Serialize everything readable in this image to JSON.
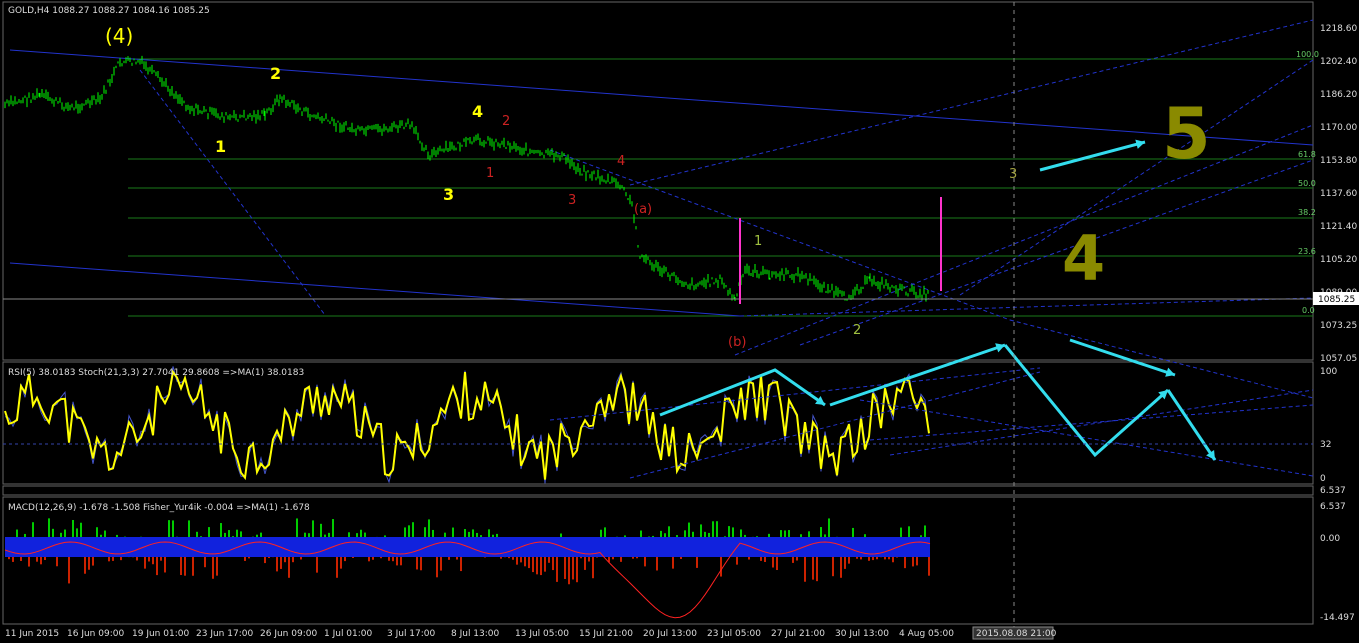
{
  "colors": {
    "background": "#000000",
    "candles": "#00ff00",
    "rsi": "#ffff00",
    "trend_lines": "#2233cc",
    "fib_levels": "#1a7a1a",
    "arrows": "#33ddee",
    "macd_hist_pos": "#00cc00",
    "macd_hist_neg": "#cc2200",
    "magenta": "#ff33cc",
    "big_numbers": "#8a8a00"
  },
  "main": {
    "header": "GOLD,H4  1088.27 1088.27 1084.16 1085.25",
    "current_price": "1085.25",
    "price_ticks": [
      "1218.60",
      "1202.40",
      "1186.20",
      "1170.00",
      "1153.80",
      "1137.60",
      "1121.40",
      "1105.20",
      "1089.00",
      "1073.25",
      "1057.05"
    ],
    "fib_labels": [
      "100.0",
      "61.8",
      "50.0",
      "38.2",
      "23.6",
      "0.0"
    ],
    "wave_labels": {
      "w4_main": "(4)",
      "y2": "2",
      "y1": "1",
      "y3": "3",
      "y4": "4",
      "r2": "2",
      "r1": "1",
      "r3": "3",
      "r4": "4",
      "ra": "(a)",
      "rb": "(b)",
      "g1": "1",
      "g2": "2",
      "g3": "3",
      "big5": "5",
      "big4": "4"
    }
  },
  "rsi": {
    "header": "RSI(5) 38.0183  Stoch(21,3,3) 27.7041 29.8608  =>MA(1) 38.0183",
    "ticks": [
      "100",
      "32",
      "0"
    ]
  },
  "mini": {
    "ticks": [
      "6.537",
      "0.00"
    ]
  },
  "macd": {
    "header": "MACD(12,26,9) -1.678 -1.508  Fisher_Yur4ik -0.004  =>MA(1) -1.678",
    "ticks": [
      "6.537",
      "0.00",
      "-14.497"
    ]
  },
  "time_axis": {
    "labels": [
      "11 Jun 2015",
      "16 Jun 09:00",
      "19 Jun 01:00",
      "23 Jun 17:00",
      "26 Jun 09:00",
      "1 Jul 01:00",
      "3 Jul 17:00",
      "8 Jul 13:00",
      "13 Jul 05:00",
      "15 Jul 21:00",
      "20 Jul 13:00",
      "23 Jul 05:00",
      "27 Jul 21:00",
      "30 Jul 13:00",
      "4 Aug 05:00"
    ],
    "cursor_label": "2015.08.08 21:00"
  }
}
